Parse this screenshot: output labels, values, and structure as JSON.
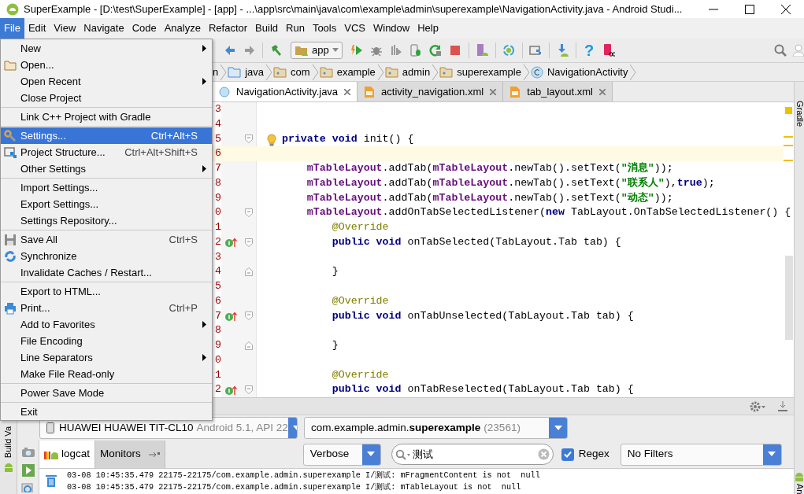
{
  "window": {
    "title": "SuperExample - [D:\\test\\SuperExample] - [app] - ...\\app\\src\\main\\java\\com\\example\\admin\\superexample\\NavigationActivity.java - Android Studi..."
  },
  "menu_bar": [
    {
      "label": "File",
      "selected": true
    },
    {
      "label": "Edit",
      "selected": false
    },
    {
      "label": "View",
      "selected": false
    },
    {
      "label": "Navigate",
      "selected": false
    },
    {
      "label": "Code",
      "selected": false
    },
    {
      "label": "Analyze",
      "selected": false
    },
    {
      "label": "Refactor",
      "selected": false
    },
    {
      "label": "Build",
      "selected": false
    },
    {
      "label": "Run",
      "selected": false
    },
    {
      "label": "Tools",
      "selected": false
    },
    {
      "label": "VCS",
      "selected": false
    },
    {
      "label": "Window",
      "selected": false
    },
    {
      "label": "Help",
      "selected": false
    }
  ],
  "file_menu": [
    {
      "kind": "item",
      "label": "New",
      "submenu": true,
      "selected": false
    },
    {
      "kind": "item",
      "label": "Open...",
      "icon": true,
      "selected": false
    },
    {
      "kind": "item",
      "label": "Open Recent",
      "submenu": true,
      "selected": false
    },
    {
      "kind": "item",
      "label": "Close Project",
      "selected": false
    },
    {
      "kind": "separator"
    },
    {
      "kind": "item",
      "label": "Link C++ Project with Gradle",
      "selected": false
    },
    {
      "kind": "separator"
    },
    {
      "kind": "item",
      "label": "Settings...",
      "icon": true,
      "shortcut": "Ctrl+Alt+S",
      "selected": true
    },
    {
      "kind": "item",
      "label": "Project Structure...",
      "icon": true,
      "shortcut": "Ctrl+Alt+Shift+S",
      "selected": false
    },
    {
      "kind": "item",
      "label": "Other Settings",
      "submenu": true,
      "selected": false
    },
    {
      "kind": "separator"
    },
    {
      "kind": "item",
      "label": "Import Settings...",
      "selected": false
    },
    {
      "kind": "item",
      "label": "Export Settings...",
      "selected": false
    },
    {
      "kind": "item",
      "label": "Settings Repository...",
      "selected": false
    },
    {
      "kind": "separator"
    },
    {
      "kind": "item",
      "label": "Save All",
      "icon": true,
      "shortcut": "Ctrl+S",
      "selected": false
    },
    {
      "kind": "item",
      "label": "Synchronize",
      "icon": true,
      "selected": false
    },
    {
      "kind": "item",
      "label": "Invalidate Caches / Restart...",
      "selected": false
    },
    {
      "kind": "separator"
    },
    {
      "kind": "item",
      "label": "Export to HTML...",
      "selected": false
    },
    {
      "kind": "item",
      "label": "Print...",
      "icon": true,
      "shortcut": "Ctrl+P",
      "selected": false
    },
    {
      "kind": "item",
      "label": "Add to Favorites",
      "submenu": true,
      "selected": false
    },
    {
      "kind": "item",
      "label": "File Encoding",
      "selected": false
    },
    {
      "kind": "item",
      "label": "Line Separators",
      "submenu": true,
      "selected": false
    },
    {
      "kind": "item",
      "label": "Make File Read-only",
      "selected": false
    },
    {
      "kind": "separator"
    },
    {
      "kind": "item",
      "label": "Power Save Mode",
      "selected": false
    },
    {
      "kind": "separator"
    },
    {
      "kind": "item",
      "label": "Exit",
      "selected": false
    }
  ],
  "toolbar": [
    {
      "kind": "icon"
    },
    {
      "kind": "icon"
    },
    {
      "kind": "separator"
    },
    {
      "kind": "icon"
    },
    {
      "kind": "dropdown",
      "label": "app"
    },
    {
      "kind": "icon"
    },
    {
      "kind": "icon"
    },
    {
      "kind": "icon"
    },
    {
      "kind": "icon"
    },
    {
      "kind": "icon"
    },
    {
      "kind": "icon"
    },
    {
      "kind": "separator"
    },
    {
      "kind": "icon"
    },
    {
      "kind": "separator"
    },
    {
      "kind": "icon"
    },
    {
      "kind": "separator"
    },
    {
      "kind": "icon"
    },
    {
      "kind": "separator"
    },
    {
      "kind": "icon"
    },
    {
      "kind": "separator"
    },
    {
      "kind": "glyph",
      "text": "?"
    },
    {
      "kind": "icon"
    }
  ],
  "toolbar_right": [
    {
      "kind": "icon"
    },
    {
      "kind": "icon"
    }
  ],
  "breadcrumbs": [
    {
      "label": "n"
    },
    {
      "label": "java",
      "icon": true
    },
    {
      "label": "com",
      "icon": true
    },
    {
      "label": "example",
      "icon": true
    },
    {
      "label": "admin",
      "icon": true
    },
    {
      "label": "superexample",
      "icon": true
    },
    {
      "label": "NavigationActivity",
      "icon": true
    }
  ],
  "editor_tabs": [
    {
      "label": "NavigationActivity.java",
      "selected": true
    },
    {
      "label": "activity_navigation.xml",
      "selected": false
    },
    {
      "label": "tab_layout.xml",
      "selected": false
    }
  ],
  "code_lines": [
    {
      "number": "3"
    },
    {
      "number": "4"
    },
    {
      "number": "5",
      "fold_start": true,
      "bulb": true,
      "tokens": [
        {
          "t": "    private void",
          "kind": "keyword"
        },
        {
          "t": " init() {",
          "kind": "plain"
        }
      ]
    },
    {
      "number": "6",
      "current": true
    },
    {
      "number": "7",
      "tokens": [
        {
          "t": "        mTableLayout",
          "kind": "field"
        },
        {
          "t": ".addTab(",
          "kind": "plain"
        },
        {
          "t": "mTableLayout",
          "kind": "field"
        },
        {
          "t": ".newTab().setText(",
          "kind": "plain"
        },
        {
          "t": "\"消息\"",
          "kind": "string"
        },
        {
          "t": "));",
          "kind": "plain"
        }
      ]
    },
    {
      "number": "8",
      "tokens": [
        {
          "t": "        mTableLayout",
          "kind": "field"
        },
        {
          "t": ".addTab(",
          "kind": "plain"
        },
        {
          "t": "mTableLayout",
          "kind": "field"
        },
        {
          "t": ".newTab().setText(",
          "kind": "plain"
        },
        {
          "t": "\"联系人\"",
          "kind": "string"
        },
        {
          "t": "),",
          "kind": "plain"
        },
        {
          "t": "true",
          "kind": "keyword"
        },
        {
          "t": ");",
          "kind": "plain"
        }
      ]
    },
    {
      "number": "9",
      "tokens": [
        {
          "t": "        mTableLayout",
          "kind": "field"
        },
        {
          "t": ".addTab(",
          "kind": "plain"
        },
        {
          "t": "mTableLayout",
          "kind": "field"
        },
        {
          "t": ".newTab().setText(",
          "kind": "plain"
        },
        {
          "t": "\"动态\"",
          "kind": "string"
        },
        {
          "t": "));",
          "kind": "plain"
        }
      ]
    },
    {
      "number": "0",
      "fold_start": true,
      "tokens": [
        {
          "t": "        mTableLayout",
          "kind": "field"
        },
        {
          "t": ".addOnTabSelectedListener(",
          "kind": "plain"
        },
        {
          "t": "new",
          "kind": "keyword"
        },
        {
          "t": " TabLayout.OnTabSelectedListener() {",
          "kind": "plain"
        }
      ]
    },
    {
      "number": "1",
      "tokens": [
        {
          "t": "            @Override",
          "kind": "annotation"
        }
      ]
    },
    {
      "number": "2",
      "override": true,
      "fold_start": true,
      "tokens": [
        {
          "t": "            public void",
          "kind": "keyword"
        },
        {
          "t": " onTabSelected(TabLayout.Tab tab) {",
          "kind": "plain"
        }
      ]
    },
    {
      "number": "3"
    },
    {
      "number": "4",
      "fold_end": true,
      "tokens": [
        {
          "t": "            }",
          "kind": "plain"
        }
      ]
    },
    {
      "number": "5"
    },
    {
      "number": "6",
      "tokens": [
        {
          "t": "            @Override",
          "kind": "annotation"
        }
      ]
    },
    {
      "number": "7",
      "override": true,
      "fold_start": true,
      "tokens": [
        {
          "t": "            public void",
          "kind": "keyword"
        },
        {
          "t": " onTabUnselected(TabLayout.Tab tab) {",
          "kind": "plain"
        }
      ]
    },
    {
      "number": "8"
    },
    {
      "number": "9",
      "fold_end": true,
      "tokens": [
        {
          "t": "            }",
          "kind": "plain"
        }
      ]
    },
    {
      "number": "0"
    },
    {
      "number": "1",
      "tokens": [
        {
          "t": "            @Override",
          "kind": "annotation"
        }
      ]
    },
    {
      "number": "2",
      "override": true,
      "fold_start": true,
      "tokens": [
        {
          "t": "            public void",
          "kind": "keyword"
        },
        {
          "t": " onTabReselected(TabLayout.Tab tab) {",
          "kind": "plain"
        }
      ]
    }
  ],
  "side_tabs": {
    "left": "Build Va",
    "right_top": "Gradle",
    "right_bottom": "An"
  },
  "logcat": {
    "device": {
      "name": "HUAWEI HUAWEI TIT-CL10",
      "detail": "Android 5.1, API 22"
    },
    "process": {
      "name": "com.example.admin.**superexample**",
      "pid": "(23561)"
    },
    "tabs": [
      {
        "label": "logcat",
        "selected": true
      },
      {
        "label": "Monitors",
        "selected": false
      }
    ],
    "level": "Verbose",
    "search": {
      "value": "测试"
    },
    "regex": {
      "label": "Regex",
      "checked": true
    },
    "filter": "No Filters",
    "lines": [
      "03-08 10:45:35.479 22175-22175/com.example.admin.superexample I/测试: mFragmentContent is not  null",
      "03-08 10:45:35.479 22175-22175/com.example.admin.superexample I/测试: mTableLayout is not  null"
    ]
  }
}
